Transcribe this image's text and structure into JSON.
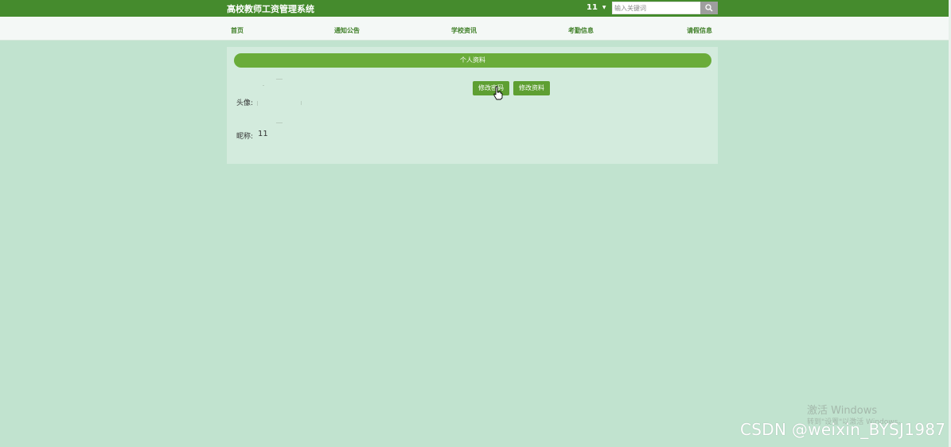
{
  "header": {
    "site_title": "高校教师工资管理系统",
    "username": "11",
    "search": {
      "value": "",
      "placeholder": "输入关键词"
    }
  },
  "nav": {
    "items": [
      {
        "label": "首页"
      },
      {
        "label": "通知公告"
      },
      {
        "label": "学校资讯"
      },
      {
        "label": "考勤信息"
      },
      {
        "label": "请假信息"
      }
    ]
  },
  "profile": {
    "title": "个人资料",
    "change_password_label": "修改密码",
    "edit_profile_label": "修改资料",
    "avatar_label": "头像:",
    "nickname_label": "昵称:",
    "nickname_value": "11"
  },
  "watermarks": {
    "windows_title": "激活 Windows",
    "windows_sub": "转到\"设置\"以激活 Windows。",
    "csdn": "CSDN @weixin_BYSJ1987"
  },
  "colors": {
    "topbar": "#458b2d",
    "background": "#c1e3cf",
    "panel": "#d3ebdd",
    "accent": "#6aac3a",
    "button": "#5e9f32"
  },
  "icons": {
    "search": "search-icon",
    "caret": "caret-down-icon",
    "cursor": "hand-pointer-icon"
  }
}
